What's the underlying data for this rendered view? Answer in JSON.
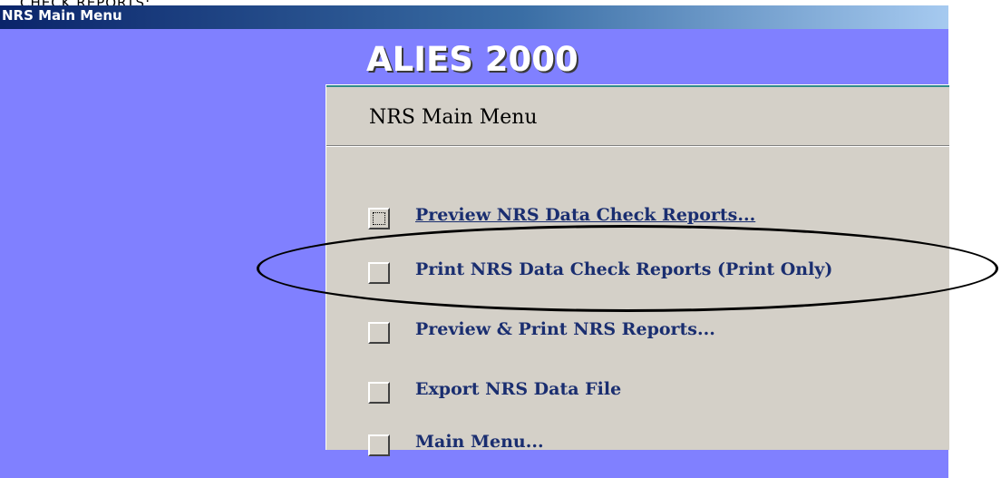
{
  "top_caption": "CHECK REPORTS:",
  "window": {
    "title": "NRS Main Menu"
  },
  "app": {
    "title": "ALIES 2000"
  },
  "panel": {
    "header": "NRS Main Menu",
    "items": [
      {
        "label": "Preview NRS Data Check Reports..."
      },
      {
        "label": "Print NRS Data Check Reports (Print Only)"
      },
      {
        "label": "Preview & Print NRS Reports..."
      },
      {
        "label": "Export NRS Data File"
      },
      {
        "label": "Main Menu..."
      }
    ]
  },
  "colors": {
    "background": "#8080ff",
    "panel": "#d4d0c8",
    "label": "#1a2e70",
    "accent_line": "#2e8b8b"
  }
}
